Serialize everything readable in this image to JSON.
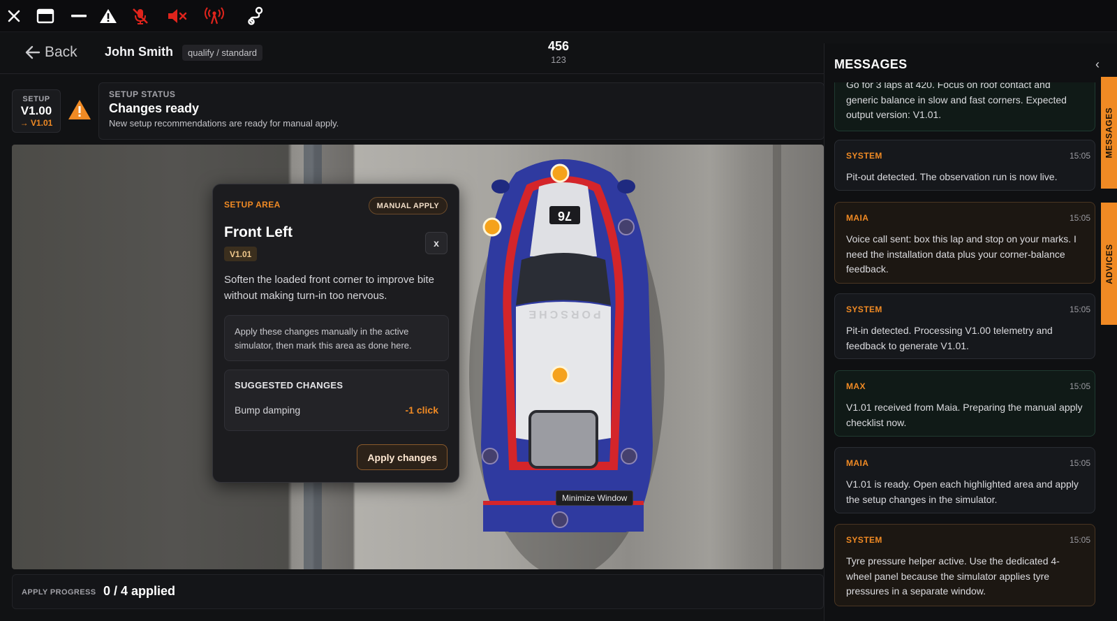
{
  "toolbar": {
    "icons": [
      "close-icon",
      "window-icon",
      "minimize-icon",
      "warning-icon",
      "mic-muted-icon",
      "speaker-muted-icon",
      "antenna-icon",
      "route-icon"
    ]
  },
  "header": {
    "back_label": "Back",
    "driver_name": "John Smith",
    "session_mode": "qualify / standard",
    "counter_main": "456",
    "counter_sub": "123"
  },
  "setup": {
    "label": "SETUP",
    "current_version": "V1.00",
    "next_version": "→ V1.01"
  },
  "status": {
    "label": "SETUP STATUS",
    "title": "Changes ready",
    "description": "New setup recommendations are ready for manual apply."
  },
  "setup_area": {
    "label": "SETUP AREA",
    "chip": "MANUAL APPLY",
    "title": "Front Left",
    "version": "V1.01",
    "close_label": "x",
    "description": "Soften the loaded front corner to improve bite without making turn-in too nervous.",
    "note": "Apply these changes manually in the active simulator, then mark this area as done here.",
    "changes_header": "SUGGESTED CHANGES",
    "changes": [
      {
        "name": "Bump damping",
        "value": "-1 click"
      }
    ],
    "apply_label": "Apply changes"
  },
  "car": {
    "number": "76",
    "brand": "PORSCHE"
  },
  "tooltip": "Minimize Window",
  "progress": {
    "label": "APPLY PROGRESS",
    "value": "0 / 4 applied"
  },
  "messages": {
    "title": "MESSAGES",
    "collapse": "‹",
    "top_partial_text": "Go for 3 laps at 420. Focus on roof contact and generic balance in slow and fast corners. Expected output version: V1.01.",
    "items": [
      {
        "sender": "SYSTEM",
        "time": "15:05",
        "text": "Pit-out detected. The observation run is now live.",
        "kind": "system"
      },
      {
        "sender": "MAIA",
        "time": "15:05",
        "text": "Voice call sent: box this lap and stop on your marks. I need the installation data plus your corner-balance feedback.",
        "kind": "maia"
      },
      {
        "sender": "SYSTEM",
        "time": "15:05",
        "text": "Pit-in detected. Processing V1.00 telemetry and feedback to generate V1.01.",
        "kind": "system"
      },
      {
        "sender": "MAX",
        "time": "15:05",
        "text": "V1.01 received from Maia. Preparing the manual apply checklist now.",
        "kind": "max"
      },
      {
        "sender": "MAIA",
        "time": "15:05",
        "text": "V1.01 is ready. Open each highlighted area and apply the setup changes in the simulator.",
        "kind": "maia"
      },
      {
        "sender": "SYSTEM",
        "time": "15:05",
        "text": "Tyre pressure helper active. Use the dedicated 4-wheel panel because the simulator applies tyre pressures in a separate window.",
        "kind": "system"
      }
    ]
  },
  "side_tabs": [
    "MESSAGES",
    "ADVICES"
  ],
  "colors": {
    "accent": "#f08a24",
    "alert_red": "#e0241c",
    "car_blue": "#2f3aa0",
    "car_red": "#d4252a"
  }
}
